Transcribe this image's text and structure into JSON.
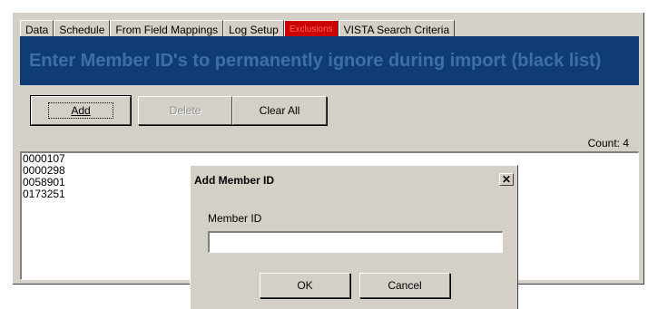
{
  "tabs": [
    {
      "label": "Data"
    },
    {
      "label": "Schedule"
    },
    {
      "label": "From Field Mappings"
    },
    {
      "label": "Log Setup"
    },
    {
      "label": "Exclusions",
      "active": true
    },
    {
      "label": "VISTA Search Criteria"
    }
  ],
  "banner": {
    "text": "Enter Member ID's to permanently ignore during import (black list)"
  },
  "toolbar": {
    "add_label": "Add",
    "delete_label": "Delete",
    "clear_all_label": "Clear All",
    "count_text": "Count: 4"
  },
  "member_list": [
    "0000107",
    "0000298",
    "0058901",
    "0173251"
  ],
  "dialog": {
    "title": "Add Member ID",
    "close_glyph": "✕",
    "field_label": "Member ID",
    "field_value": "",
    "ok_label": "OK",
    "cancel_label": "Cancel"
  },
  "colors": {
    "banner_bg": "#0f3d73",
    "banner_text": "#3c6fa8",
    "active_tab_bg": "#cc0000",
    "active_tab_text": "#ff6666",
    "face": "#d4d0c8"
  }
}
